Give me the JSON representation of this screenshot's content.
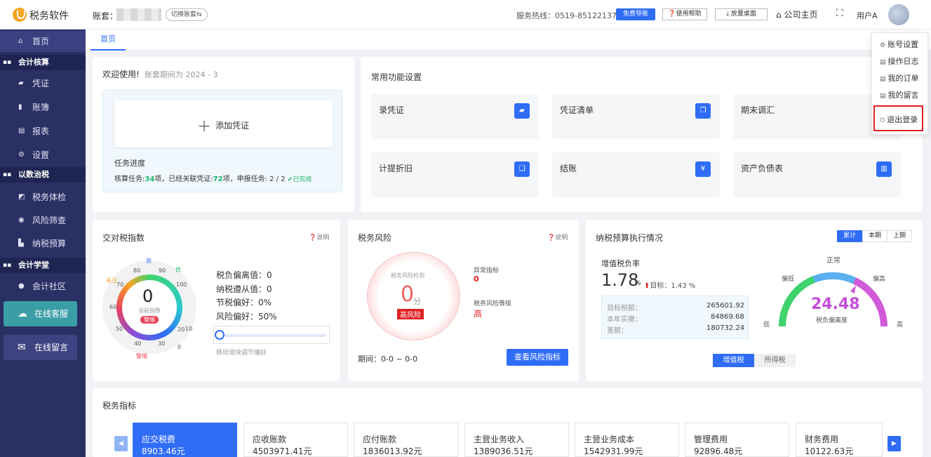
{
  "topbar": {
    "logo_text": "税务软件",
    "account_label": "账套：",
    "switch_label": "切换账套",
    "switch_arrow": "⇆",
    "hotline": "服务热线：0519-85122137",
    "free_guide": "免费导账",
    "help": "使用帮助",
    "desktop": "放置桌面",
    "home": "公司主页",
    "user": "用户A"
  },
  "sidebar": {
    "home": "首页",
    "group_accounting": "会计核算",
    "voucher": "凭证",
    "ledger": "账簿",
    "report": "报表",
    "settings": "设置",
    "group_tax": "以数治税",
    "tax_check": "税务体检",
    "risk_screen": "风险筛查",
    "tax_budget": "纳税预算",
    "group_school": "会计学堂",
    "community": "会计社区",
    "online_service": "在线客服",
    "online_message": "在线留言"
  },
  "tabs": {
    "home": "首页"
  },
  "welcome": {
    "title": "欢迎使用!",
    "period": "账套期间为 2024 - 3",
    "add_voucher": "添加凭证",
    "task_progress": "任务进度",
    "task_prefix": "核算任务:",
    "task_count": "34",
    "task_mid": "项，已经关联凭证:",
    "linked_count": "72",
    "task_suffix": "项，申报任务: 2 / 2",
    "done": "已完成"
  },
  "common_funcs": {
    "title": "常用功能设置",
    "items": [
      "录凭证",
      "凭证清单",
      "期末调汇",
      "计提折旧",
      "结账",
      "资产负债表"
    ]
  },
  "tax_index": {
    "title": "交对税指数",
    "explain": "说明",
    "value": "0",
    "sub": "当前指数",
    "badge": "警惕",
    "ticks": [
      "0",
      "10",
      "20",
      "30",
      "40",
      "50",
      "60",
      "70",
      "80",
      "90",
      "100"
    ],
    "zone_good": "良",
    "zone_excellent": "优",
    "zone_attention": "关注",
    "zone_warning": "警惕",
    "stats": [
      "税负偏离值：0",
      "纳税遵从值：0",
      "节税偏好：0%",
      "风险偏好：50%"
    ],
    "slider_hint": "移动滑块调节偏好",
    "slider_level": 0
  },
  "tax_risk": {
    "title": "税务风险",
    "explain": "说明",
    "detect": "税务风险检测",
    "score": "0",
    "unit": "分",
    "level_badge": "高风险",
    "abnormal_label": "异常指标",
    "abnormal_value": "0",
    "risk_level_label": "税务风险等级",
    "risk_level_value": "高",
    "period": "期间：0-0 ~ 0-0",
    "view_btn": "查看风险指标"
  },
  "budget": {
    "title": "纳税预算执行情况",
    "tabs": [
      "累计",
      "本期",
      "上期"
    ],
    "vat_rate_label": "增值税负率",
    "vat_rate_value": "1.78",
    "vat_rate_unit": "%",
    "target_label": "目标：",
    "target_value": "1.43 %",
    "rows": [
      {
        "label": "目标税额：",
        "value": "265601.92"
      },
      {
        "label": "本年实缴：",
        "value": "84869.68"
      },
      {
        "label": "差额：",
        "value": "180732.24"
      }
    ],
    "gauge_value": "24.48",
    "gauge_label": "税负偏离度",
    "gauge_normal": "正常",
    "gauge_low": "偏低",
    "gauge_high": "偏高",
    "gauge_min": "低",
    "gauge_max": "高",
    "bottom_tabs": [
      "增值税",
      "所得税"
    ]
  },
  "indicators": {
    "title": "税务指标",
    "items": [
      {
        "label": "应交税费",
        "value": "8903.46元"
      },
      {
        "label": "应收账款",
        "value": "4503971.41元"
      },
      {
        "label": "应付账款",
        "value": "1836013.92元"
      },
      {
        "label": "主营业务收入",
        "value": "1389036.51元"
      },
      {
        "label": "主营业务成本",
        "value": "1542931.99元"
      },
      {
        "label": "管理费用",
        "value": "92896.48元"
      },
      {
        "label": "财务费用",
        "value": "10122.63元"
      }
    ]
  },
  "dropdown": {
    "account_settings": "账号设置",
    "operation_log": "操作日志",
    "my_orders": "我的订单",
    "my_messages": "我的留言",
    "logout": "退出登录"
  },
  "colors": {
    "primary": "#2f6df6",
    "sidebar": "#2a3064",
    "danger": "#e02020",
    "success": "#18b566",
    "gauge_value": "#c44fd8"
  }
}
